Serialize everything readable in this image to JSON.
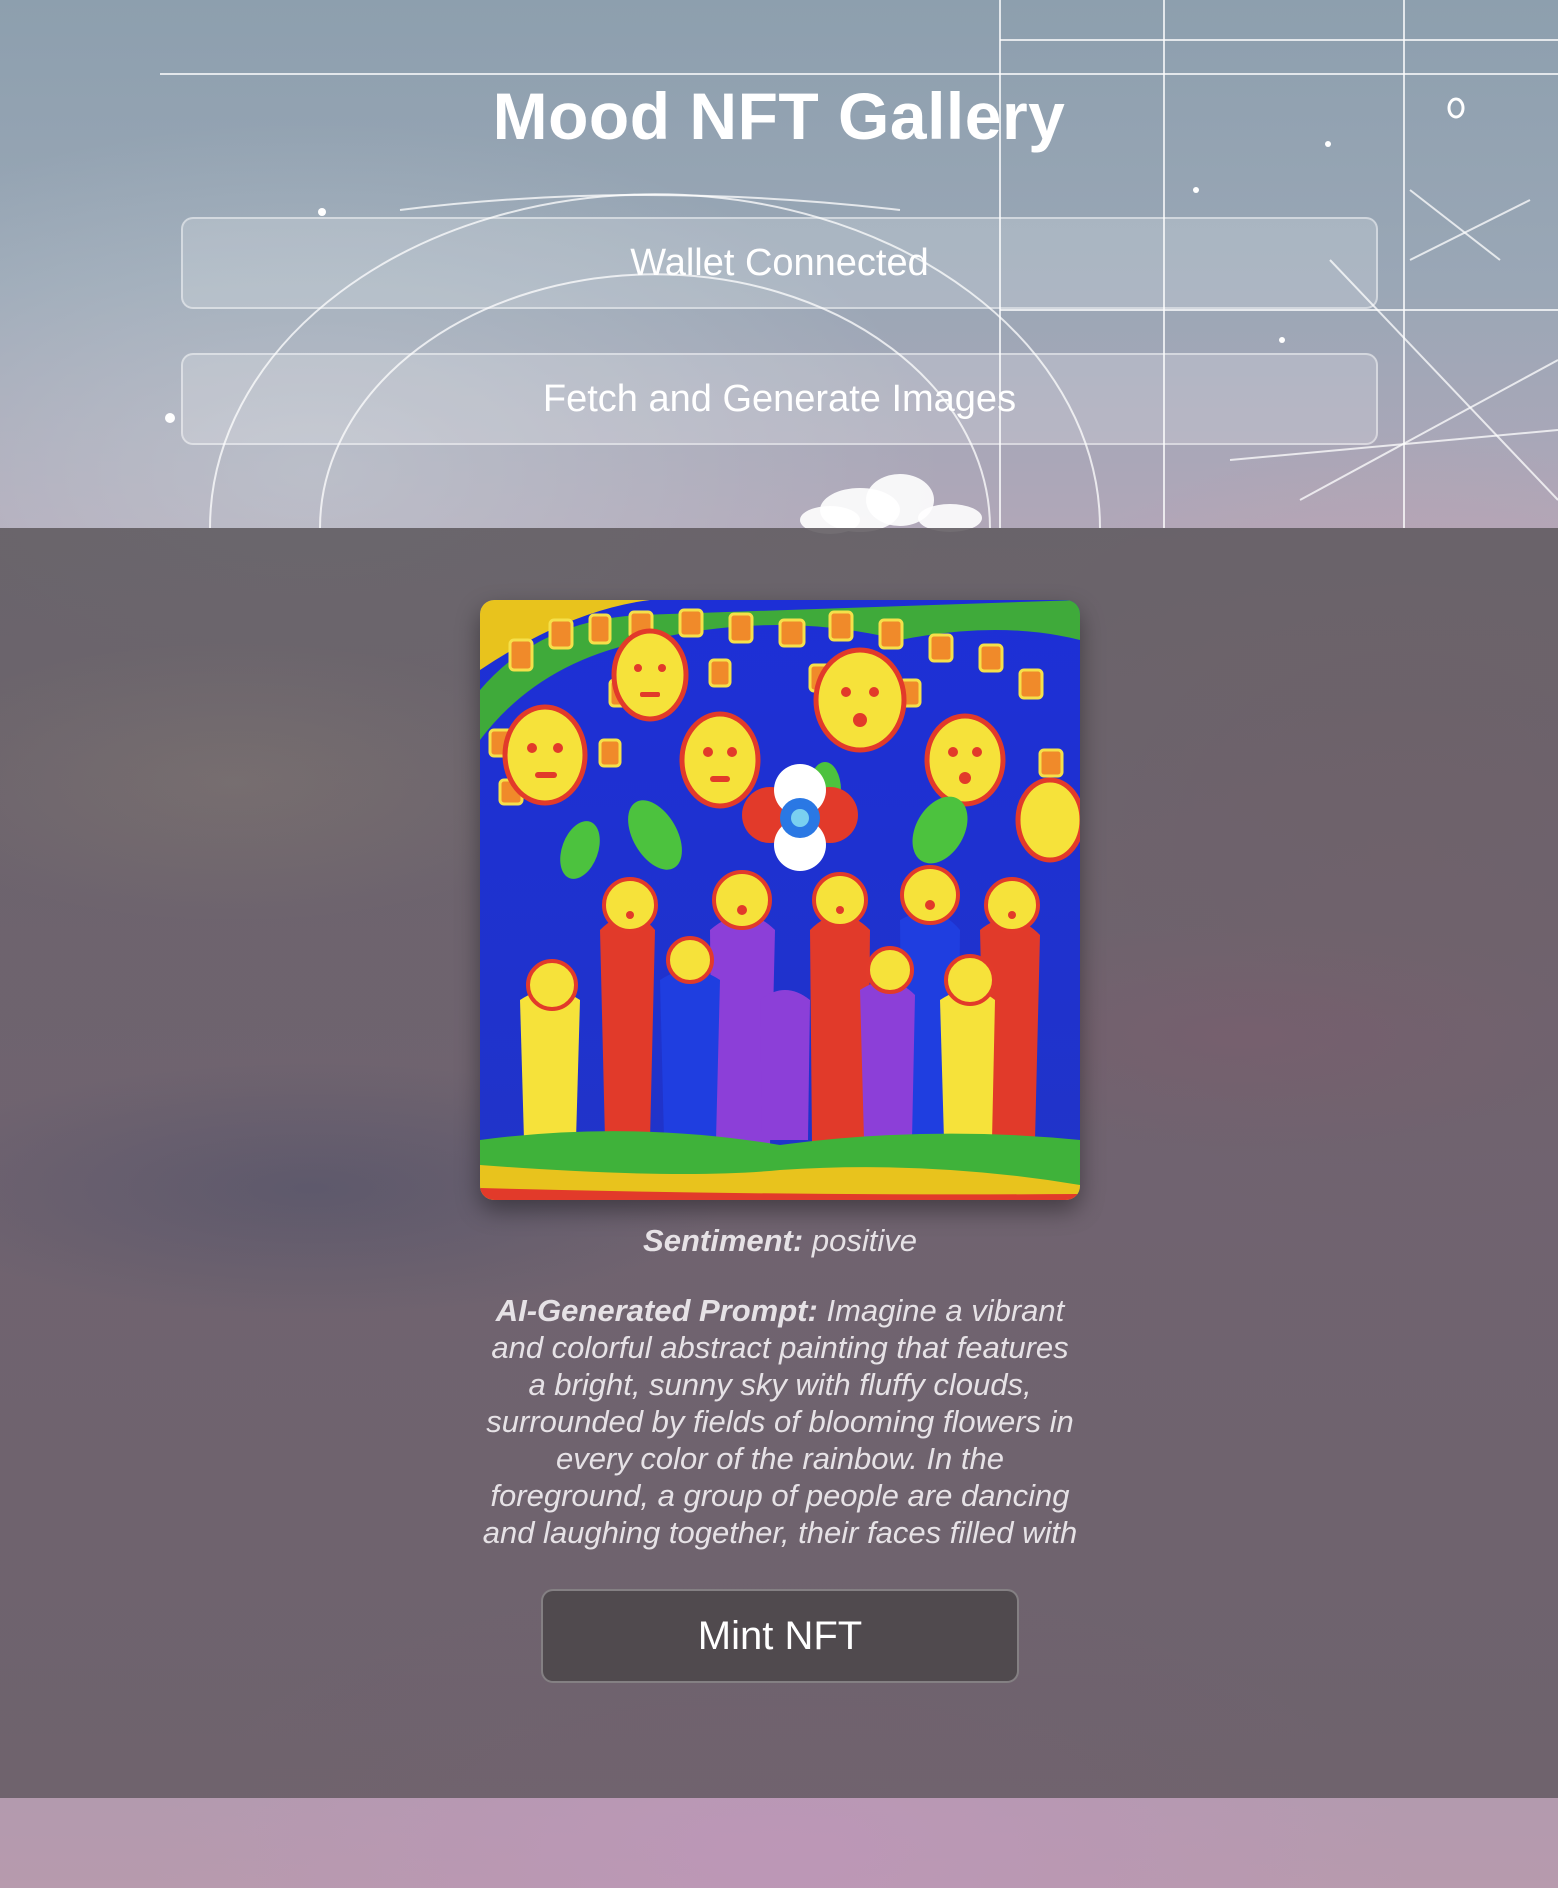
{
  "app": {
    "title": "Mood NFT Gallery"
  },
  "actions": {
    "wallet_label": "Wallet Connected",
    "fetch_label": "Fetch and Generate Images"
  },
  "nft": {
    "image_alt": "Colorful abstract painting of smiling sun faces, flowers and dancing people",
    "sentiment_label": "Sentiment:",
    "sentiment_value": "positive",
    "prompt_label": "AI-Generated Prompt:",
    "prompt_text": "Imagine a vibrant and colorful abstract painting that features a bright, sunny sky with fluffy clouds, surrounded by fields of blooming flowers in every color of the rainbow. In the foreground, a group of people are dancing and laughing together, their faces filled with",
    "mint_label": "Mint NFT"
  },
  "colors": {
    "title": "#ffffff",
    "button_bg": "rgba(255,255,255,0.18)",
    "mint_bg": "#4a4446",
    "caption_text": "#e6e2e6"
  }
}
